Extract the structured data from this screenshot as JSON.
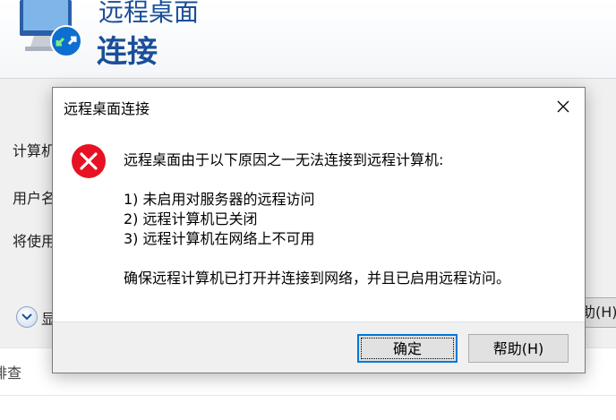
{
  "background_window": {
    "title_small": "远程桌面",
    "title_big": "连接",
    "form_labels": [
      "计算机",
      "用户名",
      "将使用"
    ],
    "options_label": "显",
    "help_button_partial": "助(H)",
    "bottom_text": "排查"
  },
  "dialog": {
    "title": "远程桌面连接",
    "message_lines": [
      "远程桌面由于以下原因之一无法连接到远程计算机:",
      "",
      "1) 未启用对服务器的远程访问",
      "2) 远程计算机已关闭",
      "3) 远程计算机在网络上不可用",
      "",
      "确保远程计算机已打开并连接到网络，并且已启用远程访问。"
    ],
    "ok_label": "确定",
    "help_label": "帮助(H)",
    "icon": "error-icon",
    "error_color": "#e81123"
  }
}
